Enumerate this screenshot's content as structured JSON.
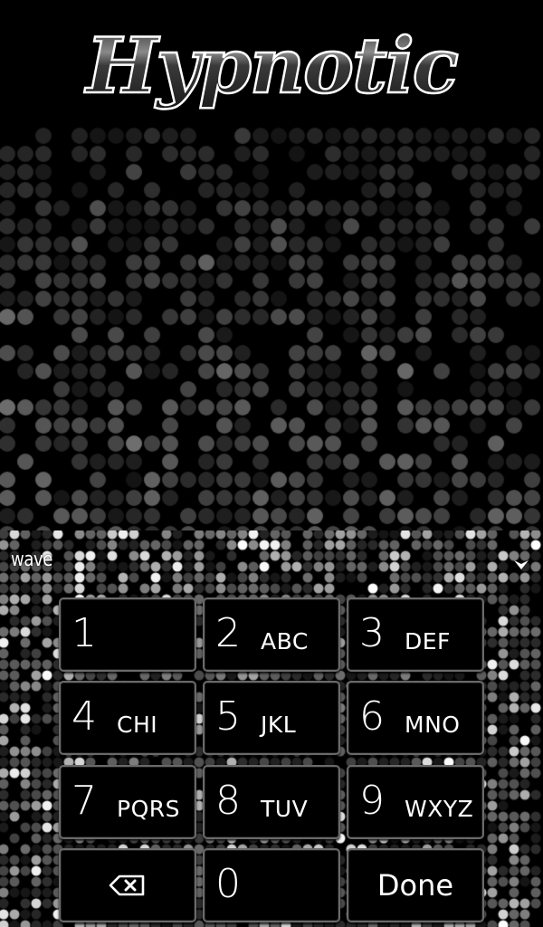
{
  "header": {
    "title": "Hypnotic"
  },
  "theme": {
    "background": "#000000",
    "key_background": "#000000",
    "key_border": "#6a6a6a",
    "text_color": "#ffffff"
  },
  "keyboard": {
    "suggestion": "wave",
    "collapse_icon": "chevron-down-icon",
    "keys": [
      {
        "digit": "1",
        "letters": ""
      },
      {
        "digit": "2",
        "letters": "ABC"
      },
      {
        "digit": "3",
        "letters": "DEF"
      },
      {
        "digit": "4",
        "letters": "CHI"
      },
      {
        "digit": "5",
        "letters": "JKL"
      },
      {
        "digit": "6",
        "letters": "MNO"
      },
      {
        "digit": "7",
        "letters": "PQRS"
      },
      {
        "digit": "8",
        "letters": "TUV"
      },
      {
        "digit": "9",
        "letters": "WXYZ"
      }
    ],
    "backspace_icon": "backspace-icon",
    "zero": "0",
    "done_label": "Done"
  }
}
